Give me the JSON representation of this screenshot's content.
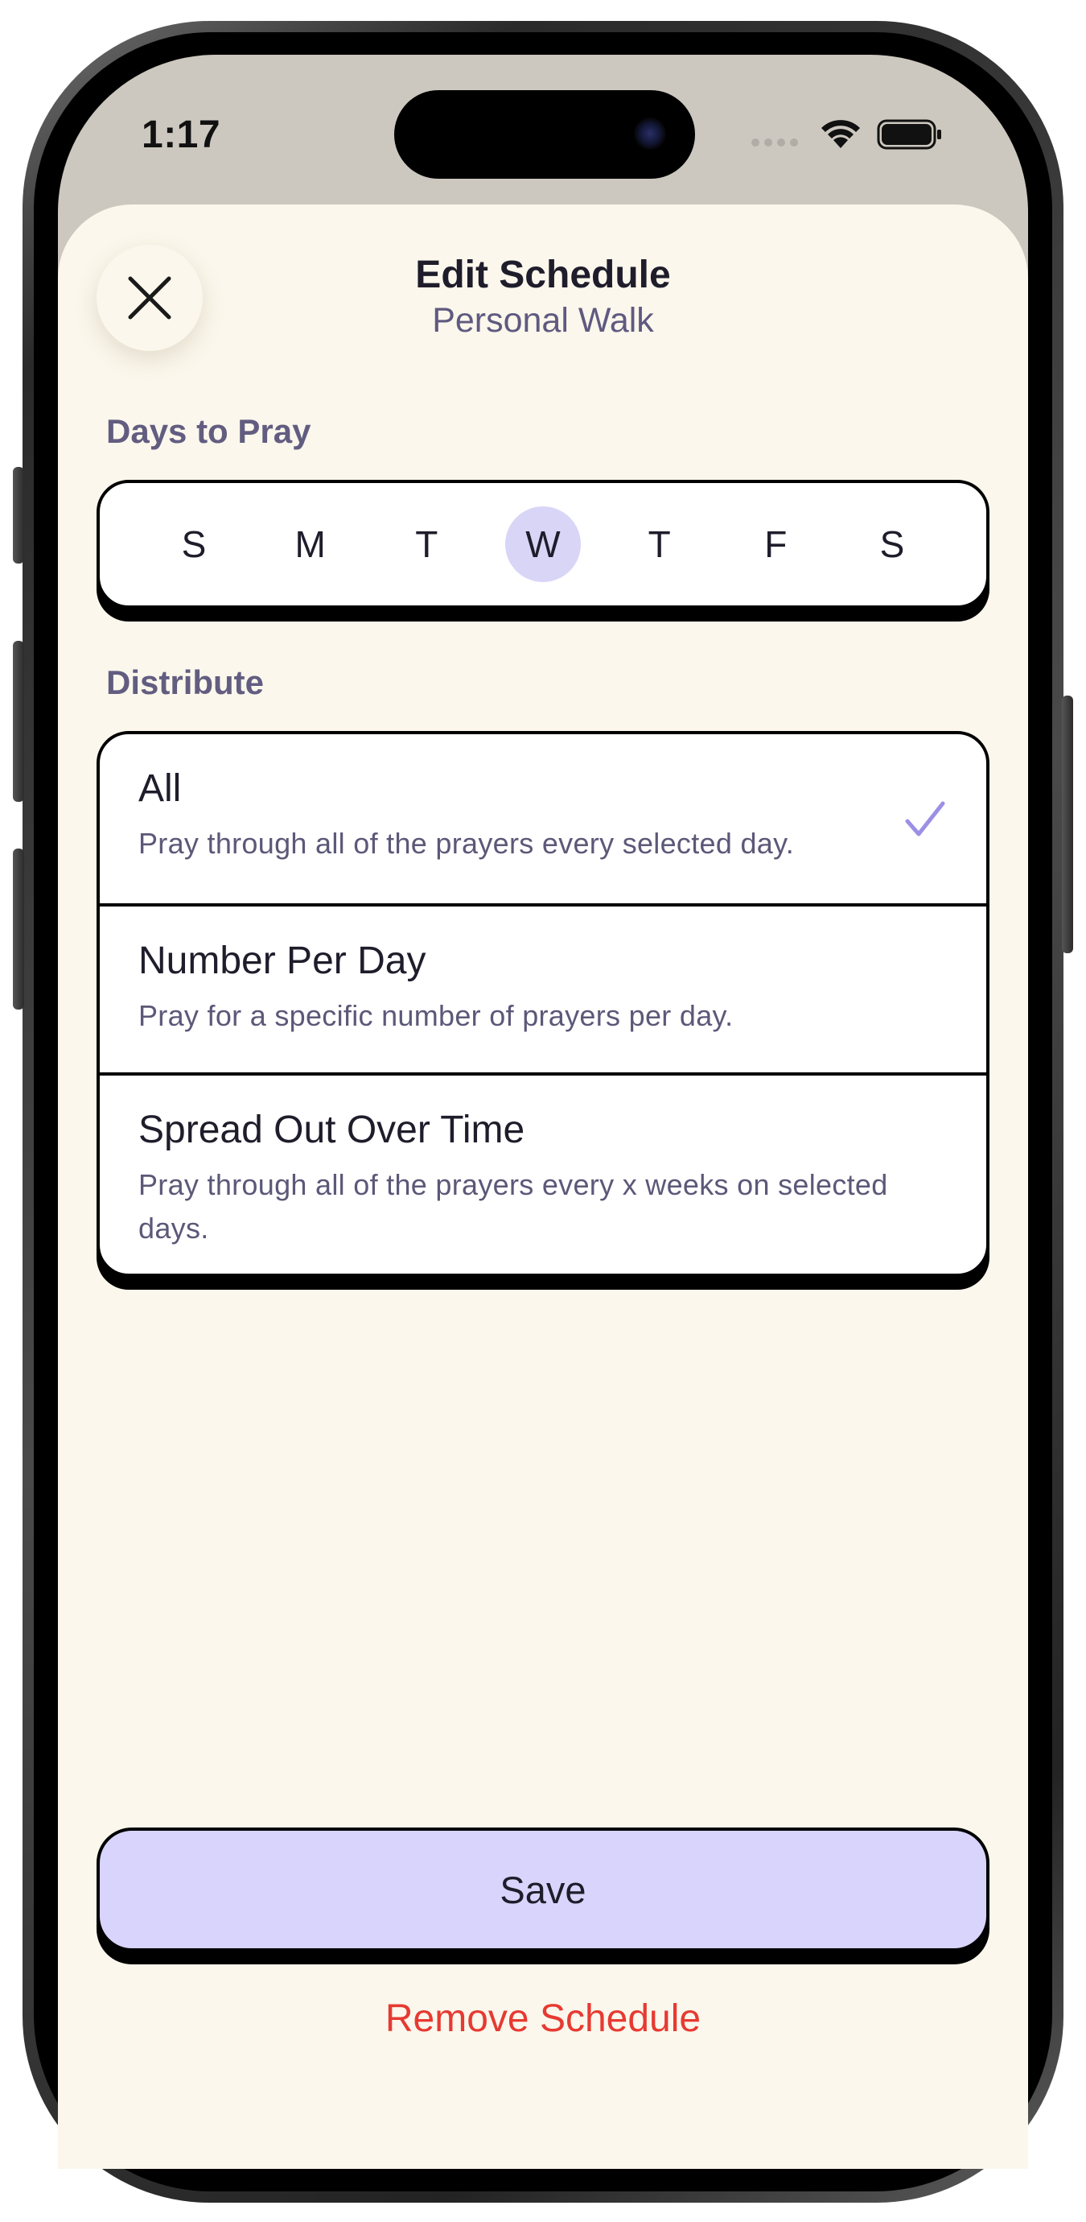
{
  "status_bar": {
    "time": "1:17"
  },
  "header": {
    "title": "Edit Schedule",
    "subtitle": "Personal Walk",
    "close_icon": "close-icon"
  },
  "days_section": {
    "label": "Days to Pray",
    "days": [
      {
        "letter": "S",
        "selected": false
      },
      {
        "letter": "M",
        "selected": false
      },
      {
        "letter": "T",
        "selected": false
      },
      {
        "letter": "W",
        "selected": true
      },
      {
        "letter": "T",
        "selected": false
      },
      {
        "letter": "F",
        "selected": false
      },
      {
        "letter": "S",
        "selected": false
      }
    ]
  },
  "distribute_section": {
    "label": "Distribute",
    "options": [
      {
        "title": "All",
        "description": "Pray through all of the prayers every selected day.",
        "selected": true
      },
      {
        "title": "Number Per Day",
        "description": "Pray for a specific number of prayers per day.",
        "selected": false
      },
      {
        "title": "Spread Out Over Time",
        "description": "Pray through all of the prayers every x weeks on selected days.",
        "selected": false
      }
    ]
  },
  "actions": {
    "save_label": "Save",
    "remove_label": "Remove Schedule"
  },
  "colors": {
    "background": "#fbf7ec",
    "selected_day": "#d9d5f7",
    "save_button": "#d8d4fb",
    "check": "#9b8fe6",
    "remove_text": "#e63a32"
  }
}
